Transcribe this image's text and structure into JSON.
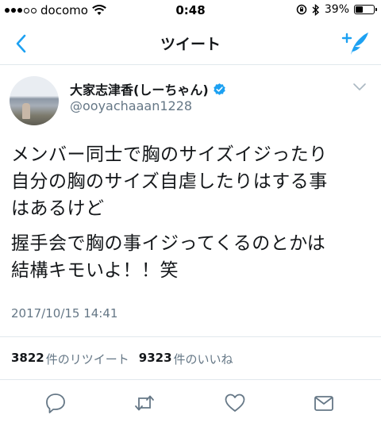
{
  "status_bar": {
    "carrier": "docomo",
    "time": "0:48",
    "battery": "39%",
    "battery_level": 0.39
  },
  "nav": {
    "title": "ツイート"
  },
  "tweet": {
    "display_name": "大家志津香(しーちゃん)",
    "handle": "@ooyachaaan1228",
    "paragraphs": [
      "メンバー同士で胸のサイズイジったり\n自分の胸のサイズ自虐したりはする事\nはあるけど",
      "握手会で胸の事イジってくるのとかは\n結構キモいよ！！笑"
    ],
    "timestamp": "2017/10/15 14:41",
    "retweets": {
      "count": "3822",
      "label": "件のリツイート"
    },
    "likes": {
      "count": "9323",
      "label": "件のいいね"
    }
  },
  "colors": {
    "accent": "#1da1f2",
    "secondary_text": "#657786",
    "divider": "#e1e8ed"
  },
  "icons": [
    "back-chevron-icon",
    "compose-tweet-icon",
    "verified-badge-icon",
    "caret-down-icon",
    "reply-icon",
    "retweet-icon",
    "like-icon",
    "direct-message-icon"
  ]
}
